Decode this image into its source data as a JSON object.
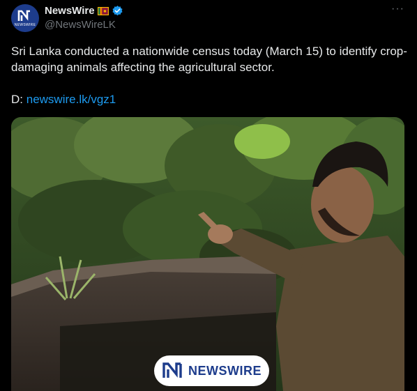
{
  "post": {
    "author_name": "NewsWire",
    "handle": "@NewsWireLK",
    "avatar_text": "NEWSWIRE",
    "flag_icon": "sri-lanka-flag-icon",
    "verified_icon": "verified-badge-icon",
    "more_label": "···",
    "text": "Sri Lanka conducted a nationwide census today (March 15) to identify crop-damaging animals affecting the agricultural sector.",
    "link_prefix": "D: ",
    "link_text": "newswire.lk/vgz1"
  },
  "media": {
    "watermark_text": "NEWSWIRE"
  },
  "colors": {
    "background": "#000000",
    "text": "#e7e9ea",
    "muted": "#71767b",
    "link": "#1d9bf0",
    "brand": "#1d3c8c"
  }
}
